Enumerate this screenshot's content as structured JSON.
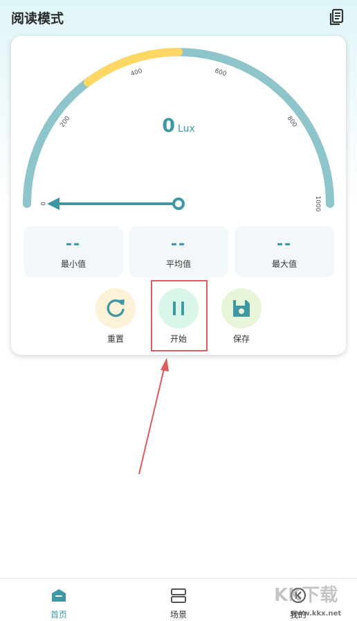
{
  "header": {
    "title": "阅读模式",
    "history_icon": "document-list-icon"
  },
  "gauge": {
    "value": "0",
    "unit": "Lux",
    "ticks": [
      "0",
      "200",
      "400",
      "600",
      "800",
      "1000"
    ],
    "track_color": "#8ec5cb",
    "highlight_color": "#ffd863",
    "needle_color": "#3f97a3"
  },
  "stats": [
    {
      "value": "--",
      "label": "最小值"
    },
    {
      "value": "--",
      "label": "平均值"
    },
    {
      "value": "--",
      "label": "最大值"
    }
  ],
  "actions": [
    {
      "label": "重置",
      "icon": "refresh-icon",
      "bg": "#fdf1d8"
    },
    {
      "label": "开始",
      "icon": "pause-icon",
      "bg": "#d9f7e9"
    },
    {
      "label": "保存",
      "icon": "save-icon",
      "bg": "#e8f5d9"
    }
  ],
  "tabs": [
    {
      "label": "首页",
      "icon": "home-icon",
      "active": true
    },
    {
      "label": "场景",
      "icon": "scenes-icon",
      "active": false
    },
    {
      "label": "我的",
      "icon": "profile-icon",
      "active": false
    }
  ],
  "watermark": {
    "text": "KK下载",
    "url": "www.kkx.net"
  },
  "colors": {
    "accent": "#3f97a3",
    "annotation": "#e05b5b"
  }
}
